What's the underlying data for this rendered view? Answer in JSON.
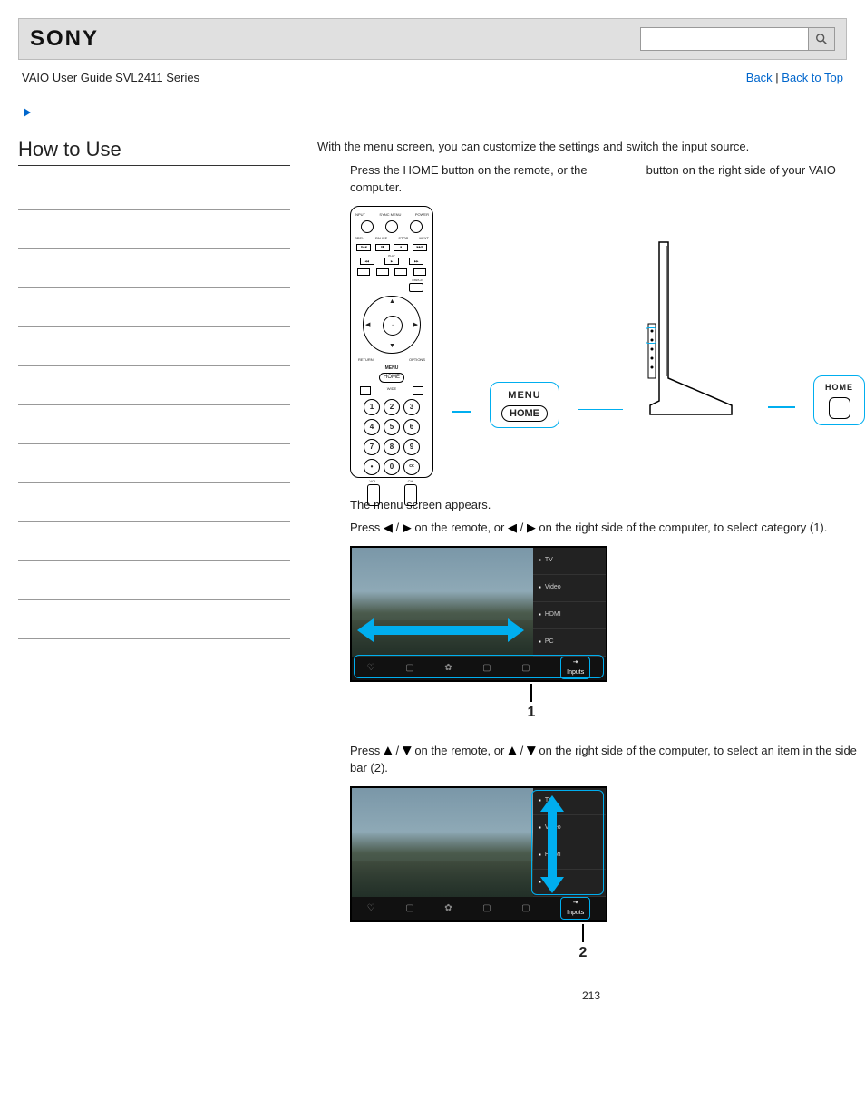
{
  "header": {
    "logo_text": "SONY",
    "search_placeholder": ""
  },
  "subheader": {
    "left": "VAIO User Guide SVL2411 Series",
    "back_label": "Back",
    "separator": " | ",
    "back_to_top_label": "Back to Top"
  },
  "sidebar": {
    "title": "How to Use"
  },
  "main": {
    "intro": "With the menu screen, you can customize the settings and switch the input source.",
    "step1_a": "Press the HOME button on the remote, or the",
    "step1_b": "button on the right side of your VAIO computer.",
    "callout_menu": "MENU",
    "callout_home": "HOME",
    "callout_home2": "HOME",
    "after_fig1": "The menu screen appears.",
    "step2_a": "Press",
    "step2_slash": " / ",
    "step2_b": "on the remote, or",
    "step2_c": "on the right side of the computer, to select category (1).",
    "step3_a": "Press",
    "step3_b": " on the remote, or ",
    "step3_c": " on the right side of the computer, to select an item in the side bar (2).",
    "marker1": "1",
    "marker2": "2",
    "menu_items": [
      "TV",
      "Video",
      "HDMI",
      "PC"
    ],
    "inputs_label": "Inputs"
  },
  "page_number": "213"
}
